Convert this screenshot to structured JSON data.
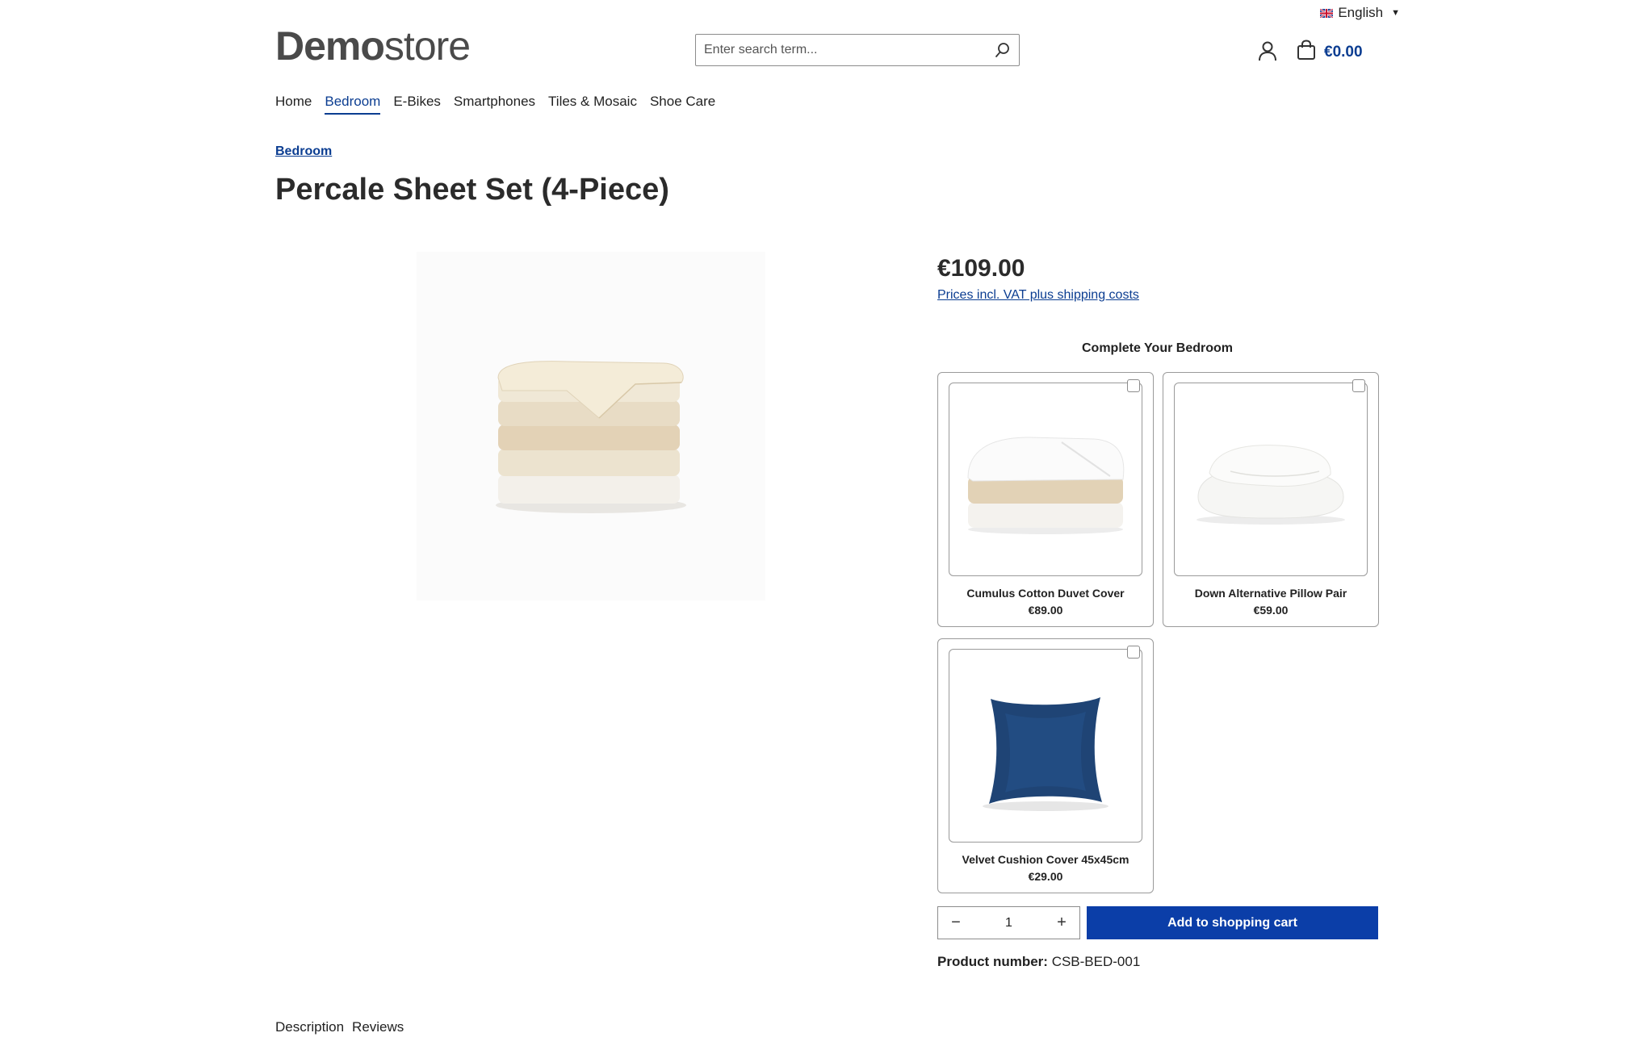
{
  "language": {
    "label": "English",
    "flag": "uk-flag-icon"
  },
  "logo": {
    "bold": "Demo",
    "light": "store"
  },
  "search": {
    "placeholder": "Enter search term..."
  },
  "header": {
    "cart_total": "€0.00"
  },
  "nav": {
    "items": [
      {
        "label": "Home",
        "active": false
      },
      {
        "label": "Bedroom",
        "active": true
      },
      {
        "label": "E-Bikes",
        "active": false
      },
      {
        "label": "Smartphones",
        "active": false
      },
      {
        "label": "Tiles & Mosaic",
        "active": false
      },
      {
        "label": "Shoe Care",
        "active": false
      }
    ]
  },
  "breadcrumb": {
    "label": "Bedroom"
  },
  "product": {
    "title": "Percale Sheet Set (4-Piece)",
    "price": "€109.00",
    "vat_note": "Prices incl. VAT plus shipping costs",
    "number_label": "Product number:",
    "number": "CSB-BED-001",
    "quantity": "1",
    "add_to_cart": "Add to shopping cart"
  },
  "bundle": {
    "title": "Complete Your Bedroom",
    "items": [
      {
        "name": "Cumulus Cotton Duvet Cover",
        "price": "€89.00"
      },
      {
        "name": "Down Alternative Pillow Pair",
        "price": "€59.00"
      },
      {
        "name": "Velvet Cushion Cover 45x45cm",
        "price": "€29.00"
      }
    ]
  },
  "tabs": [
    {
      "label": "Description"
    },
    {
      "label": "Reviews"
    }
  ],
  "colors": {
    "accent": "#0b3d91",
    "button": "#0b3ea8"
  }
}
